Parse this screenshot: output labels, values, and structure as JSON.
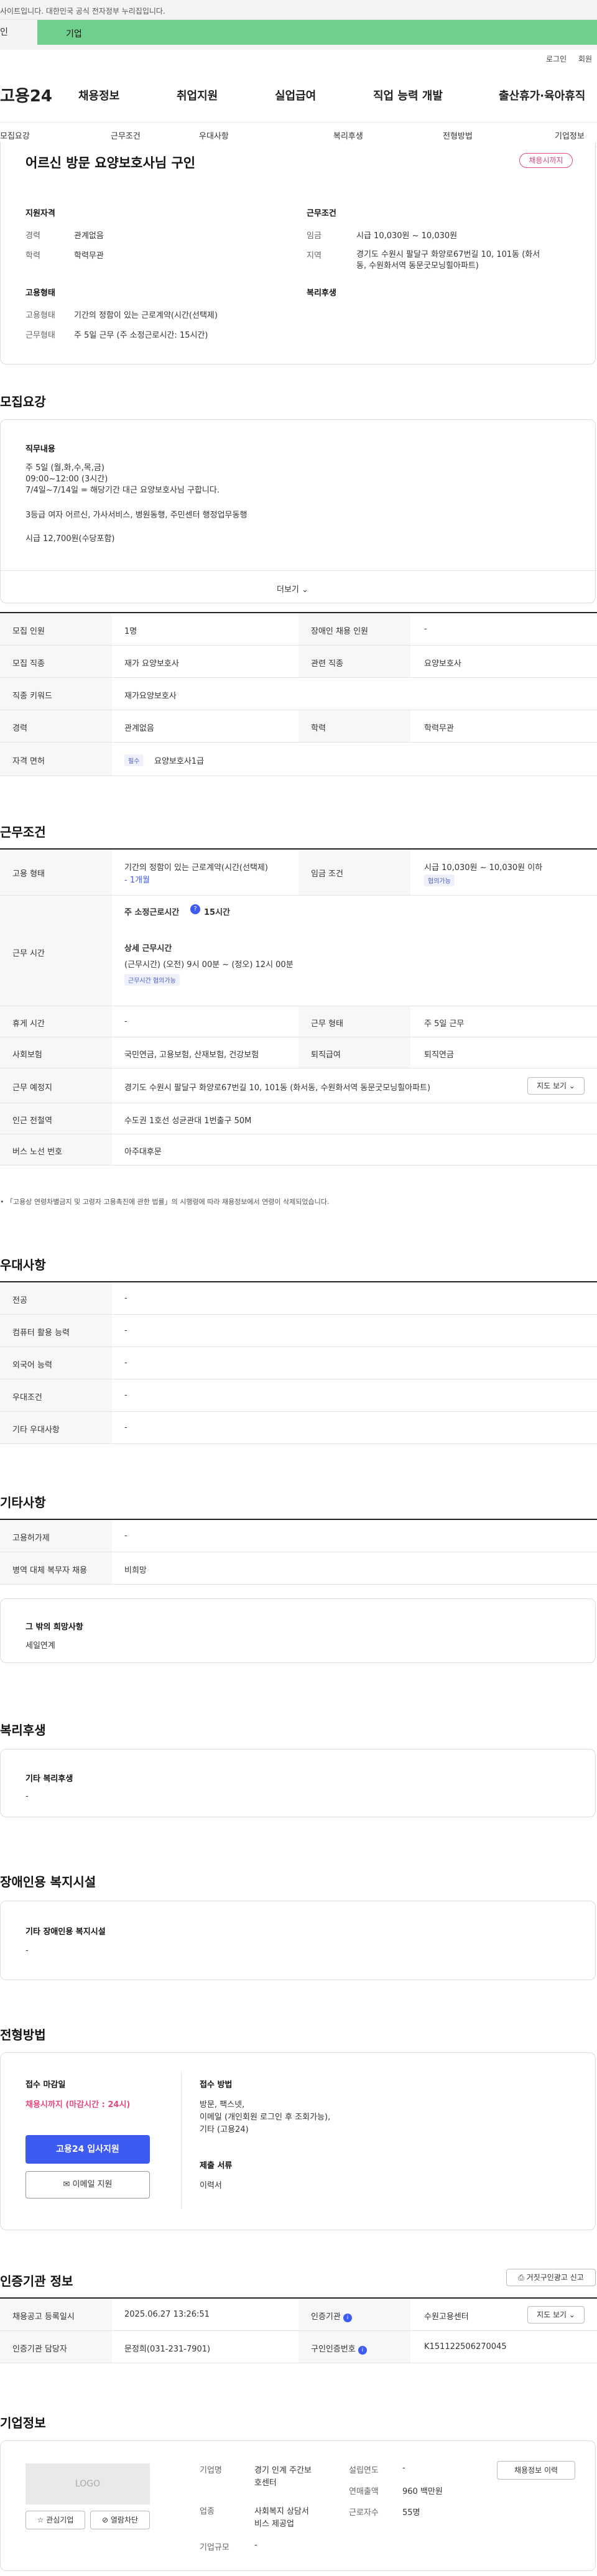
{
  "topbar": {
    "notice": "사이트입니다. 대한민국 공식 전자정부 누리집입니다."
  },
  "member_tabs": {
    "individual": "인",
    "business": "기업"
  },
  "util": {
    "login": "로그인",
    "join": "회원"
  },
  "gnb": {
    "logo": "고용24",
    "items": [
      "채용정보",
      "취업지원",
      "실업급여",
      "직업 능력 개발",
      "출산휴가·육아휴직"
    ]
  },
  "subnav": [
    "모집요강",
    "근무조건",
    "우대사항",
    "복리후생",
    "전형방법",
    "기업정보"
  ],
  "job": {
    "title": "어르신 방문 요양보호사님 구인",
    "status": "채용시까지",
    "qual_head": "지원자격",
    "career_l": "경력",
    "career_v": "관계없음",
    "edu_l": "학력",
    "edu_v": "학력무관",
    "cond_head": "근무조건",
    "wage_l": "임금",
    "wage_v": "시급 10,030원 ~ 10,030원",
    "area_l": "지역",
    "area_v1": "경기도 수원시 팔달구 화양로67번길 10, 101동 (화서",
    "area_v2": "동, 수원화서역 동문굿모닝힐아파트)",
    "emp_head": "고용형태",
    "emptype_l": "고용형태",
    "emptype_v": "기간의 정함이 있는 근로계약(시간(선택제)",
    "worktype_l": "근무형태",
    "worktype_v": "주 5일 근무 (주 소정근로시간: 15시간)",
    "welfare_head": "복리후생"
  },
  "recruit": {
    "title": "모집요강",
    "duty_head": "직무내용",
    "duty_lines": [
      "주 5일 (월,화,수,목,금)",
      "09:00~12:00 (3시간)",
      "7/4일~7/14일 = 해당기간 대근 요양보호사님 구합니다.",
      "3등급  여자 어르신, 가사서비스, 병원동행, 주민센터 행정업무동행",
      "시급 12,700원(수당포함)"
    ],
    "more": "더보기",
    "rows": [
      {
        "l1": "모집 인원",
        "v1": "1명",
        "l2": "장애인 채용 인원",
        "v2": "-"
      },
      {
        "l1": "모집 직종",
        "v1": "재가 요양보호사",
        "l2": "관련 직종",
        "v2": "요양보호사"
      },
      {
        "l1": "직종 키워드",
        "v1": "재가요양보호사"
      },
      {
        "l1": "경력",
        "v1": "관계없음",
        "l2": "학력",
        "v2": "학력무관"
      },
      {
        "l1": "자격 면허",
        "tag": "필수",
        "v1": "요양보호사1급"
      }
    ]
  },
  "conditions": {
    "title": "근무조건",
    "emptype_l": "고용 형태",
    "emptype_v": "기간의 정함이 있는 근로계약(시간(선택제)",
    "emptype_v2": "- 1개월",
    "wage_l": "임금 조건",
    "wage_v": "시급 10,030원 ~ 10,030원 이하",
    "wage_tag": "협의가능",
    "hours_l": "근무 시간",
    "weekly": "주 소정근로시간",
    "weekly_v": "15시간",
    "detail_head": "상세 근무시간",
    "detail_v": "(근무시간) (오전) 9시 00분 ~ (정오) 12시 00분",
    "detail_tag": "근무시간 협의가능",
    "rest_l": "휴게 시간",
    "rest_v": "-",
    "worktype_l": "근무 형태",
    "worktype_v": "주 5일 근무",
    "ins_l": "사회보험",
    "ins_v": "국민연금, 고용보험, 산재보험, 건강보험",
    "ret_l": "퇴직급여",
    "ret_v": "퇴직연금",
    "place_l": "근무 예정지",
    "place_v": "경기도 수원시 팔달구 화양로67번길 10, 101동 (화서동, 수원화서역 동문굿모닝힐아파트)",
    "map_btn": "지도 보기",
    "subway_l": "인근 전철역",
    "subway_v": "수도권 1호선 성균관대 1번출구 50M",
    "bus_l": "버스 노선 번호",
    "bus_v": "아주대후문",
    "notice": "「고용상 연령차별금지 및 고령자 고용촉진에 관한 법률」의 시행령에 따라 채용정보에서 연령이 삭제되었습니다."
  },
  "pref": {
    "title": "우대사항",
    "rows": [
      [
        "전공",
        "-"
      ],
      [
        "컴퓨터 활용 능력",
        "-"
      ],
      [
        "외국어 능력",
        "-"
      ],
      [
        "우대조건",
        "-"
      ],
      [
        "기타 우대사항",
        "-"
      ]
    ]
  },
  "etc": {
    "title": "기타사항",
    "rows": [
      [
        "고용허가제",
        "-"
      ],
      [
        "병역 대체 복무자 채용",
        "비희망"
      ]
    ],
    "other_head": "그 밖의 희망사항",
    "other_v": "세일연계"
  },
  "welfare": {
    "title": "복리후생",
    "head": "기타 복리후생",
    "v": "-"
  },
  "disabled": {
    "title": "장애인용 복지시설",
    "head": "기타 장애인용 복지시설",
    "v": "-"
  },
  "apply": {
    "title": "전형방법",
    "deadline_head": "접수 마감일",
    "deadline_v": "채용시까지 (마감시간 : 24시)",
    "apply_btn": "고용24 입사지원",
    "email_btn": "이메일 지원",
    "method_head": "접수 방법",
    "method_lines": [
      "방문, 팩스넷,",
      "이메일 (개인회원 로그인 후 조회가능),",
      "기타 (고용24)"
    ],
    "docs_head": "제출 서류",
    "docs_v": "이력서"
  },
  "cert": {
    "title": "인증기관 정보",
    "report_btn": "거짓구인광고 신고",
    "reg_l": "채용공고 등록일시",
    "reg_v": "2025.06.27 13:26:51",
    "org_l": "인증기관",
    "org_v": "수원고용센터",
    "map_btn": "지도 보기",
    "mgr_l": "인증기관 담당자",
    "mgr_v": "문정희(031-231-7901)",
    "no_l": "구인인증번호",
    "no_v": "K151122506270045"
  },
  "company": {
    "title": "기업정보",
    "logo": "LOGO",
    "fav_btn": "관심기업",
    "block_btn": "열람차단",
    "name_l": "기업명",
    "name_v1": "경기 인계 주간보",
    "name_v2": "호센터",
    "biz_l": "업종",
    "biz_v1": "사회복지 상담서",
    "biz_v2": "비스 제공업",
    "size_l": "기업규모",
    "size_v": "-",
    "year_l": "설립연도",
    "year_v": "-",
    "sales_l": "연매출액",
    "sales_v": "960 백만원",
    "emp_l": "근로자수",
    "emp_v": "55명",
    "jobs_btn": "채용정보 이력"
  }
}
